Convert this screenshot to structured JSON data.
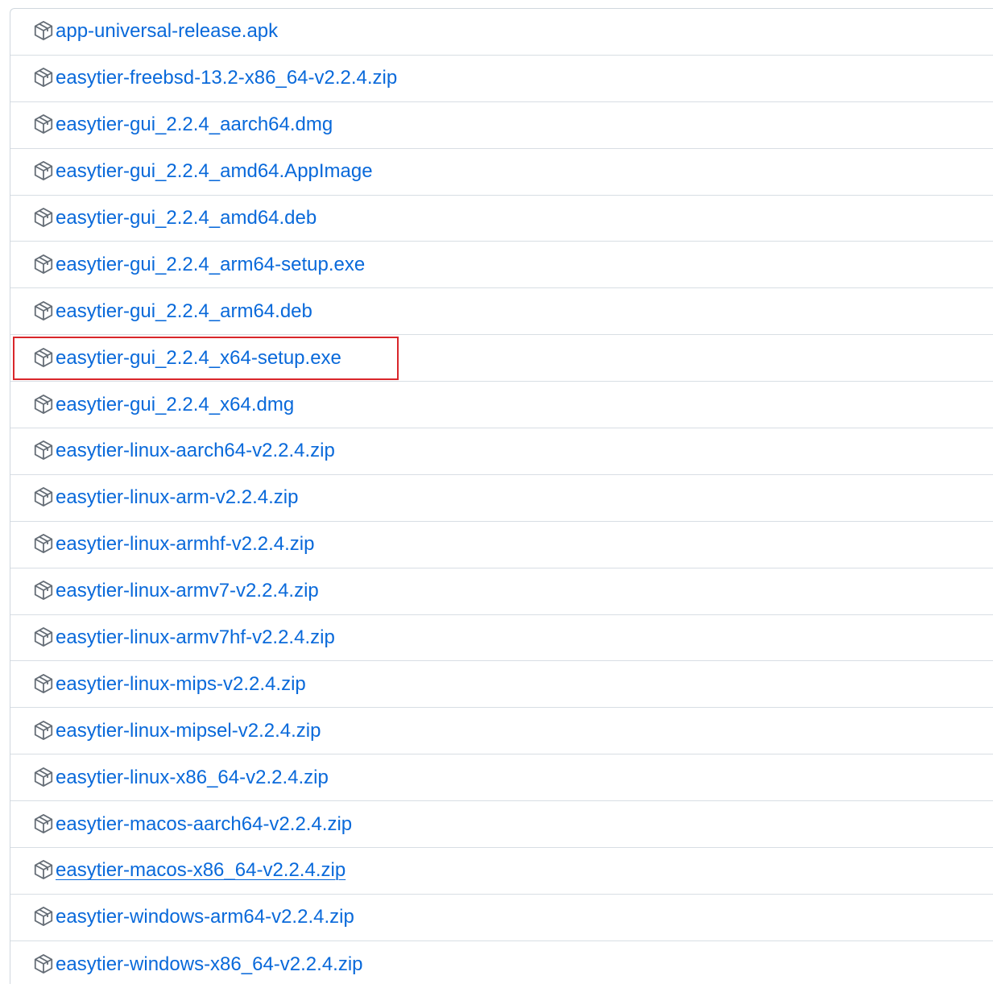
{
  "assets": {
    "icon": "package-icon",
    "link_color": "#0969da",
    "highlight_color": "#d9262b",
    "items": [
      {
        "name": "app-universal-release.apk"
      },
      {
        "name": "easytier-freebsd-13.2-x86_64-v2.2.4.zip"
      },
      {
        "name": "easytier-gui_2.2.4_aarch64.dmg"
      },
      {
        "name": "easytier-gui_2.2.4_amd64.AppImage"
      },
      {
        "name": "easytier-gui_2.2.4_amd64.deb"
      },
      {
        "name": "easytier-gui_2.2.4_arm64-setup.exe"
      },
      {
        "name": "easytier-gui_2.2.4_arm64.deb"
      },
      {
        "name": "easytier-gui_2.2.4_x64-setup.exe",
        "highlighted": true
      },
      {
        "name": "easytier-gui_2.2.4_x64.dmg"
      },
      {
        "name": "easytier-linux-aarch64-v2.2.4.zip"
      },
      {
        "name": "easytier-linux-arm-v2.2.4.zip"
      },
      {
        "name": "easytier-linux-armhf-v2.2.4.zip"
      },
      {
        "name": "easytier-linux-armv7-v2.2.4.zip"
      },
      {
        "name": "easytier-linux-armv7hf-v2.2.4.zip"
      },
      {
        "name": "easytier-linux-mips-v2.2.4.zip"
      },
      {
        "name": "easytier-linux-mipsel-v2.2.4.zip"
      },
      {
        "name": "easytier-linux-x86_64-v2.2.4.zip"
      },
      {
        "name": "easytier-macos-aarch64-v2.2.4.zip"
      },
      {
        "name": "easytier-macos-x86_64-v2.2.4.zip",
        "hovered": true
      },
      {
        "name": "easytier-windows-arm64-v2.2.4.zip"
      },
      {
        "name": "easytier-windows-x86_64-v2.2.4.zip"
      }
    ]
  }
}
